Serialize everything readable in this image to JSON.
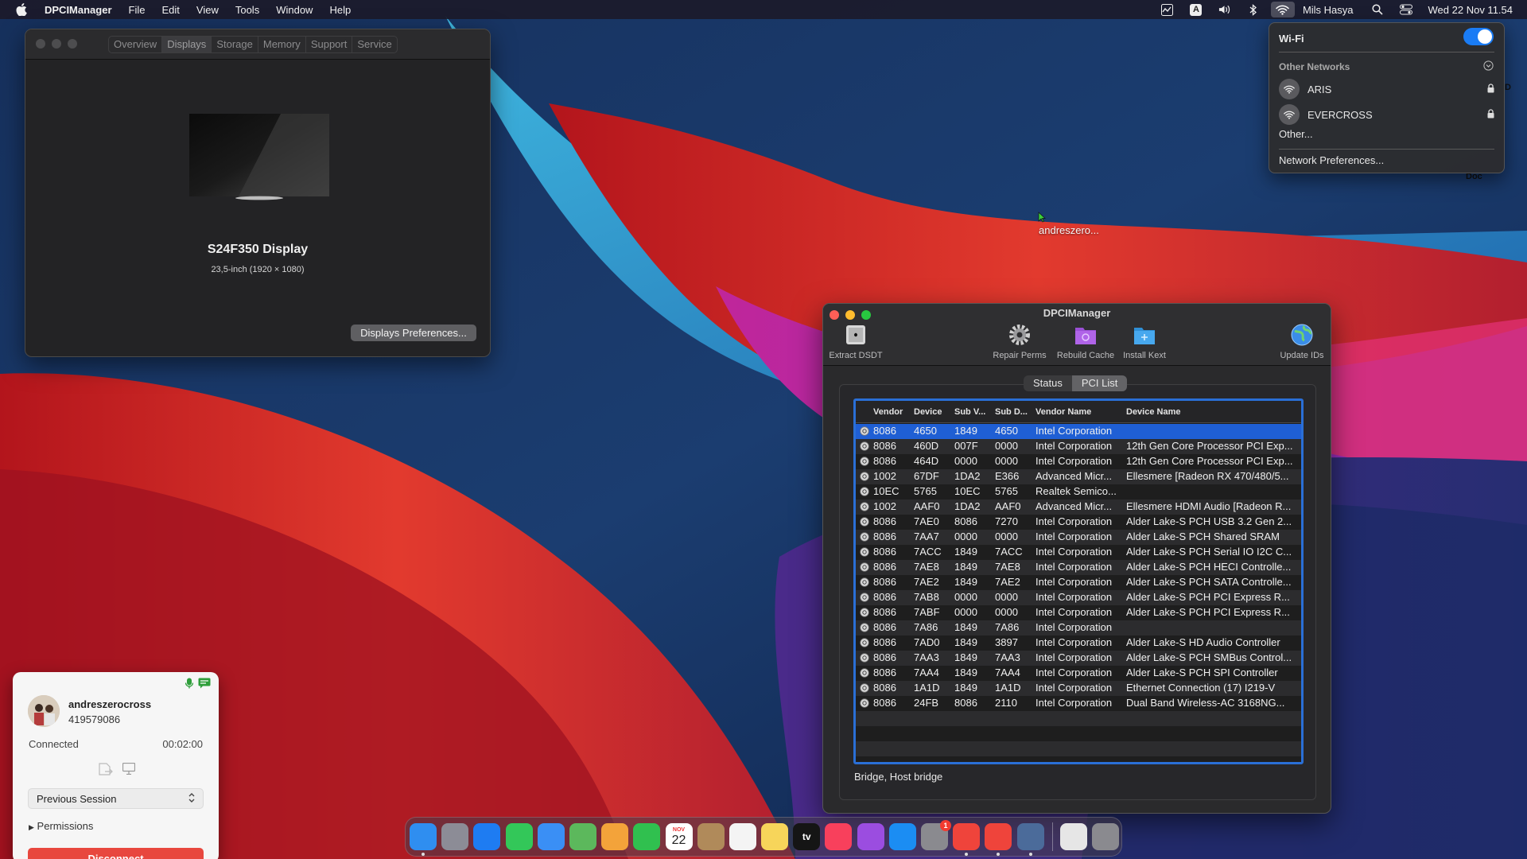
{
  "menubar": {
    "app_name": "DPCIManager",
    "menus": [
      "File",
      "Edit",
      "View",
      "Tools",
      "Window",
      "Help"
    ],
    "user": "Mils Hasya",
    "clock": "Wed 22 Nov  11.54",
    "input_source": "A"
  },
  "wifi_menu": {
    "title": "Wi-Fi",
    "enabled": true,
    "other_networks_label": "Other Networks",
    "networks": [
      {
        "name": "ARIS",
        "locked": true
      },
      {
        "name": "EVERCROSS",
        "locked": true
      }
    ],
    "other_label": "Other...",
    "preferences_label": "Network Preferences..."
  },
  "sysinfo_window": {
    "tabs": [
      "Overview",
      "Displays",
      "Storage",
      "Memory",
      "Support",
      "Service"
    ],
    "active_tab": "Displays",
    "display_name": "S24F350 Display",
    "display_size": "23,5-inch (1920 × 1080)",
    "preferences_button": "Displays Preferences..."
  },
  "desktop": {
    "label": "andreszero...",
    "doc_label": "Doc",
    "d_label": "D"
  },
  "dpci": {
    "title": "DPCIManager",
    "tools": [
      {
        "label": "Extract DSDT",
        "icon": "extract-dsdt-icon"
      },
      {
        "label": "Repair Perms",
        "icon": "gear-icon"
      },
      {
        "label": "Rebuild Cache",
        "icon": "rebuild-cache-icon"
      },
      {
        "label": "Install Kext",
        "icon": "install-kext-icon"
      },
      {
        "label": "Update IDs",
        "icon": "globe-icon"
      }
    ],
    "tabs": [
      "Status",
      "PCI List"
    ],
    "active_tab": "PCI List",
    "columns": [
      "Vendor",
      "Device",
      "Sub V...",
      "Sub D...",
      "Vendor Name",
      "Device Name"
    ],
    "rows": [
      [
        "8086",
        "4650",
        "1849",
        "4650",
        "Intel Corporation",
        ""
      ],
      [
        "8086",
        "460D",
        "007F",
        "0000",
        "Intel Corporation",
        "12th Gen Core Processor PCI Exp..."
      ],
      [
        "8086",
        "464D",
        "0000",
        "0000",
        "Intel Corporation",
        "12th Gen Core Processor PCI Exp..."
      ],
      [
        "1002",
        "67DF",
        "1DA2",
        "E366",
        "Advanced Micr...",
        "Ellesmere [Radeon RX 470/480/5..."
      ],
      [
        "10EC",
        "5765",
        "10EC",
        "5765",
        "Realtek Semico...",
        ""
      ],
      [
        "1002",
        "AAF0",
        "1DA2",
        "AAF0",
        "Advanced Micr...",
        "Ellesmere HDMI Audio [Radeon R..."
      ],
      [
        "8086",
        "7AE0",
        "8086",
        "7270",
        "Intel Corporation",
        "Alder Lake-S PCH USB 3.2 Gen 2..."
      ],
      [
        "8086",
        "7AA7",
        "0000",
        "0000",
        "Intel Corporation",
        "Alder Lake-S PCH Shared SRAM"
      ],
      [
        "8086",
        "7ACC",
        "1849",
        "7ACC",
        "Intel Corporation",
        "Alder Lake-S PCH Serial IO I2C C..."
      ],
      [
        "8086",
        "7AE8",
        "1849",
        "7AE8",
        "Intel Corporation",
        "Alder Lake-S PCH HECI Controlle..."
      ],
      [
        "8086",
        "7AE2",
        "1849",
        "7AE2",
        "Intel Corporation",
        "Alder Lake-S PCH SATA Controlle..."
      ],
      [
        "8086",
        "7AB8",
        "0000",
        "0000",
        "Intel Corporation",
        "Alder Lake-S PCH PCI Express R..."
      ],
      [
        "8086",
        "7ABF",
        "0000",
        "0000",
        "Intel Corporation",
        "Alder Lake-S PCH PCI Express R..."
      ],
      [
        "8086",
        "7A86",
        "1849",
        "7A86",
        "Intel Corporation",
        ""
      ],
      [
        "8086",
        "7AD0",
        "1849",
        "3897",
        "Intel Corporation",
        "Alder Lake-S HD Audio Controller"
      ],
      [
        "8086",
        "7AA3",
        "1849",
        "7AA3",
        "Intel Corporation",
        "Alder Lake-S PCH SMBus Control..."
      ],
      [
        "8086",
        "7AA4",
        "1849",
        "7AA4",
        "Intel Corporation",
        "Alder Lake-S PCH SPI Controller"
      ],
      [
        "8086",
        "1A1D",
        "1849",
        "1A1D",
        "Intel Corporation",
        "Ethernet Connection (17) I219-V"
      ],
      [
        "8086",
        "24FB",
        "8086",
        "2110",
        "Intel Corporation",
        "Dual Band Wireless-AC 3168NG..."
      ]
    ],
    "selected_row": 0,
    "status_text": "Bridge, Host bridge"
  },
  "session": {
    "username": "andreszerocross",
    "user_id": "419579086",
    "status": "Connected",
    "duration": "00:02:00",
    "previous_session": "Previous Session",
    "permissions": "Permissions",
    "disconnect": "Disconnect"
  },
  "dock": {
    "apps": [
      {
        "name": "Finder",
        "color": "#2f8ef0",
        "running": true
      },
      {
        "name": "Launchpad",
        "color": "#8c8c96"
      },
      {
        "name": "Safari",
        "color": "#1e7cf2"
      },
      {
        "name": "Messages",
        "color": "#33c759"
      },
      {
        "name": "Mail",
        "color": "#3a8ff5"
      },
      {
        "name": "Maps",
        "color": "#5cb85c"
      },
      {
        "name": "Photos",
        "color": "#f3a33a"
      },
      {
        "name": "FaceTime",
        "color": "#30c04f"
      },
      {
        "name": "Calendar",
        "color": "#ffffff",
        "text": "22",
        "month": "NOV"
      },
      {
        "name": "Contacts",
        "color": "#b08a5a"
      },
      {
        "name": "Reminders",
        "color": "#f4f4f4"
      },
      {
        "name": "Notes",
        "color": "#f7d55a"
      },
      {
        "name": "TV",
        "color": "#151515",
        "text": "tv"
      },
      {
        "name": "Music",
        "color": "#f8405c"
      },
      {
        "name": "Podcasts",
        "color": "#9b4de0"
      },
      {
        "name": "App Store",
        "color": "#1b8df3"
      },
      {
        "name": "System Preferences",
        "color": "#8a8a8f",
        "badge": "1"
      },
      {
        "name": "AnyDesk",
        "color": "#ef443b",
        "running": true
      },
      {
        "name": "AnyDesk Session",
        "color": "#ef443b",
        "running": true
      },
      {
        "name": "DPCIManager",
        "color": "#4b6b9a",
        "running": true
      }
    ],
    "extras": [
      {
        "name": "Documents",
        "color": "#e6e6e6"
      },
      {
        "name": "Trash",
        "color": "#8a8a8f"
      }
    ]
  }
}
